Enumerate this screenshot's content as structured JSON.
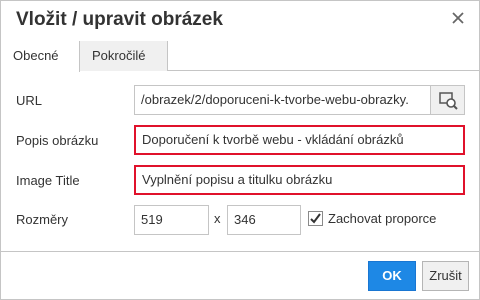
{
  "dialog": {
    "title": "Vložit / upravit obrázek",
    "close_icon": "close-icon"
  },
  "tabs": [
    {
      "label": "Obecné",
      "active": true
    },
    {
      "label": "Pokročilé",
      "active": false
    }
  ],
  "fields": {
    "url": {
      "label": "URL",
      "value": "/obrazek/2/doporuceni-k-tvorbe-webu-obrazky."
    },
    "description": {
      "label": "Popis obrázku",
      "value": "Doporučení k tvorbě webu - vkládání obrázků"
    },
    "image_title": {
      "label": "Image Title",
      "value": "Vyplnění popisu a titulku obrázku"
    },
    "dimensions": {
      "label": "Rozměry",
      "width": "519",
      "height": "346",
      "separator": "x"
    },
    "constrain": {
      "label": "Zachovat proporce",
      "checked": true
    }
  },
  "buttons": {
    "ok": "OK",
    "cancel": "Zrušit"
  },
  "colors": {
    "accent": "#1e88e5",
    "highlight": "#e0112b"
  }
}
